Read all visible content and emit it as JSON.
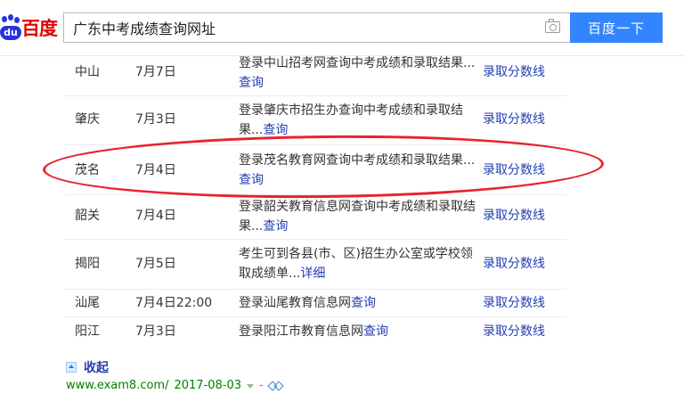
{
  "header": {
    "logo_text": "百度",
    "logo_du": "du",
    "search_value": "广东中考成绩查询网址",
    "search_button": "百度一下"
  },
  "table": {
    "rows": [
      {
        "city": "中山",
        "date": "7月7日",
        "desc_line1": "登录中山招考网查询中考成绩和录取结果...",
        "desc_line2_prefix": "",
        "desc_link": "查询",
        "link": "录取分数线"
      },
      {
        "city": "肇庆",
        "date": "7月3日",
        "desc_line1": "登录肇庆市招生办查询中考成绩和录取结",
        "desc_line2_prefix": "果...",
        "desc_link": "查询",
        "link": "录取分数线"
      },
      {
        "city": "茂名",
        "date": "7月4日",
        "desc_line1": "登录茂名教育网查询中考成绩和录取结果...",
        "desc_line2_prefix": "",
        "desc_link": "查询",
        "link": "录取分数线"
      },
      {
        "city": "韶关",
        "date": "7月4日",
        "desc_line1": "登录韶关教育信息网查询中考成绩和录取结",
        "desc_line2_prefix": "果...",
        "desc_link": "查询",
        "link": "录取分数线"
      },
      {
        "city": "揭阳",
        "date": "7月5日",
        "desc_line1": "考生可到各县(市、区)招生办公室或学校领",
        "desc_line2_prefix": "取成绩单...",
        "desc_link": "详细",
        "link": "录取分数线"
      },
      {
        "city": "汕尾",
        "date": "7月4日22:00",
        "desc_prefix": "登录汕尾教育信息网",
        "desc_link": "查询",
        "link": "录取分数线"
      },
      {
        "city": "阳江",
        "date": "7月3日",
        "desc_prefix": "登录阳江市教育信息网",
        "desc_link": "查询",
        "link": "录取分数线"
      }
    ]
  },
  "footer": {
    "collapse_label": "收起",
    "source_url": "www.exam8.com/",
    "source_date": "2017-08-03",
    "dash": "-"
  },
  "colors": {
    "accent": "#3385ff",
    "link": "#2440b3",
    "annotation": "#e8232e",
    "source": "#008000"
  }
}
